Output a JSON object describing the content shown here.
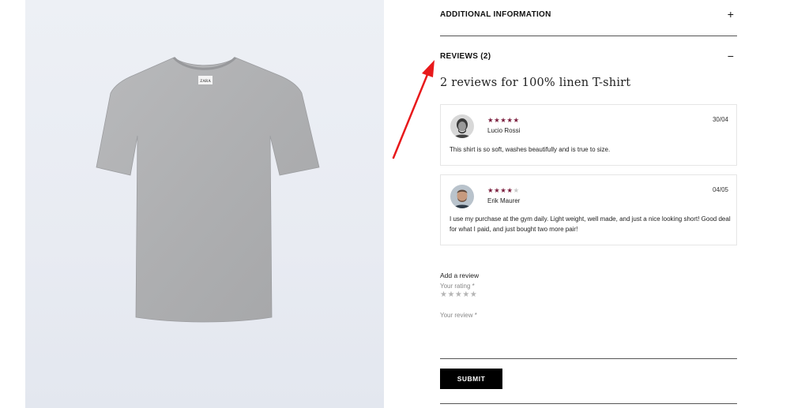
{
  "product": {
    "image_label": "ZARA"
  },
  "accordion": {
    "additional_info": {
      "label": "ADDITIONAL INFORMATION",
      "toggle": "+"
    },
    "reviews": {
      "label": "REVIEWS (2)",
      "toggle": "−"
    }
  },
  "reviews_section": {
    "title": "2 reviews for 100% linen T-shirt",
    "items": [
      {
        "name": "Lucio Rossi",
        "date": "30/04",
        "rating": 5,
        "stars_filled": "★★★★★",
        "stars_empty": "",
        "text": "This shirt is so soft, washes beautifully and is true to size."
      },
      {
        "name": "Erik Maurer",
        "date": "04/05",
        "rating": 4,
        "stars_filled": "★★★★",
        "stars_empty": "★",
        "text": "I use my purchase at the gym daily. Light weight, well made, and just a nice looking short! Good deal for what I paid, and just bought two more pair!"
      }
    ]
  },
  "review_form": {
    "heading": "Add a review",
    "rating_label": "Your rating *",
    "rating_stars": "★★★★★",
    "review_label": "Your review *",
    "review_value": "",
    "submit_label": "SUBMIT"
  },
  "colors": {
    "star_filled": "#7a1c3c",
    "star_empty": "#c8c8c8",
    "annotation_arrow": "#e8191b"
  }
}
